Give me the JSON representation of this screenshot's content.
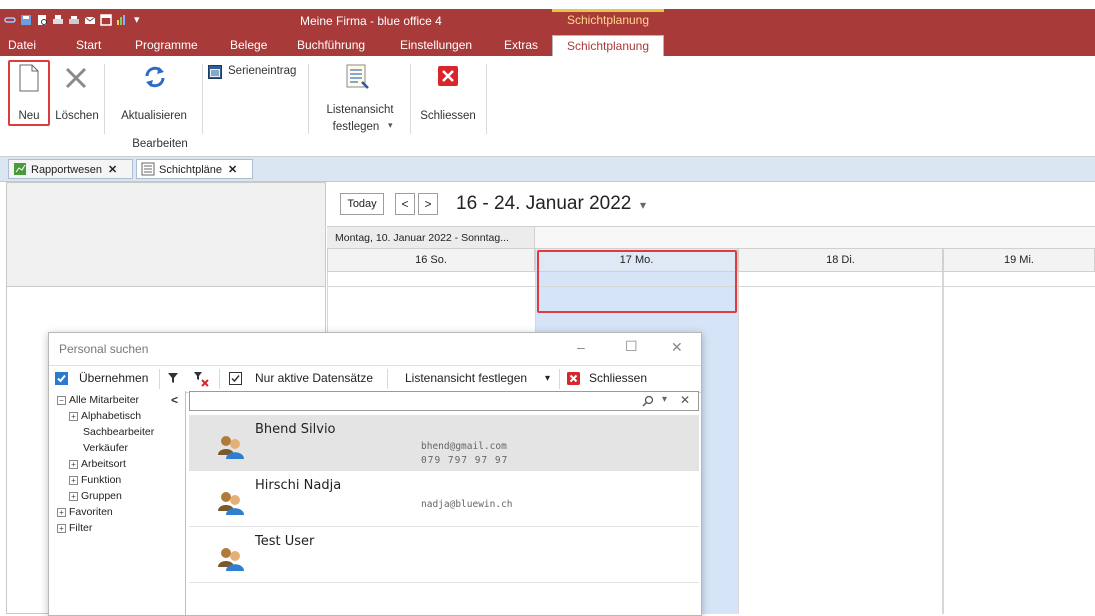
{
  "window": {
    "title": "Meine Firma - blue office 4",
    "context_tab_group": "Schichtplanung"
  },
  "menu": {
    "tabs": [
      "Datei",
      "Start",
      "Programme",
      "Belege",
      "Buchführung",
      "Einstellungen",
      "Extras"
    ],
    "active_tab": "Schichtplanung"
  },
  "ribbon": {
    "new_label": "Neu",
    "delete_label": "Löschen",
    "refresh_label": "Aktualisieren",
    "series_label": "Serieneintrag",
    "group_edit_label": "Bearbeiten",
    "list_view_label_1": "Listenansicht",
    "list_view_label_2": "festlegen",
    "close_label": "Schliessen"
  },
  "doc_tabs": [
    "Rapportwesen",
    "Schichtpläne"
  ],
  "calendar": {
    "today_label": "Today",
    "prev_icon": "chevron-left-icon",
    "next_icon": "chevron-right-icon",
    "range_label": "16 - 24. Januar 2022",
    "period_label": "Montag, 10. Januar 2022 - Sonntag...",
    "days": [
      "16 So.",
      "17 Mo.",
      "18 Di.",
      "19 Mi."
    ]
  },
  "dialog": {
    "title": "Personal suchen",
    "toolbar": {
      "apply_label": "Übernehmen",
      "active_only_label": "Nur aktive Datensätze",
      "list_view_label": "Listenansicht festlegen",
      "close_label": "Schliessen"
    },
    "tree": {
      "collapse_glyph": "<",
      "items": [
        {
          "label": "Alle Mitarbeiter",
          "level": 0,
          "expander": "−"
        },
        {
          "label": "Alphabetisch",
          "level": 1,
          "expander": "+"
        },
        {
          "label": "Sachbearbeiter",
          "level": 2,
          "expander": ""
        },
        {
          "label": "Verkäufer",
          "level": 2,
          "expander": ""
        },
        {
          "label": "Arbeitsort",
          "level": 1,
          "expander": "+"
        },
        {
          "label": "Funktion",
          "level": 1,
          "expander": "+"
        },
        {
          "label": "Gruppen",
          "level": 1,
          "expander": "+"
        },
        {
          "label": "Favoriten",
          "level": 0,
          "expander": "+"
        },
        {
          "label": "Filter",
          "level": 0,
          "expander": "+"
        }
      ]
    },
    "results": [
      {
        "name": "Bhend Silvio",
        "email": "bhend@gmail.com",
        "phone": "079 797 97 97"
      },
      {
        "name": "Hirschi Nadja",
        "email": "nadja@bluewin.ch",
        "phone": ""
      },
      {
        "name": "Test User",
        "email": "",
        "phone": ""
      }
    ]
  },
  "colors": {
    "brand": "#a93a3a",
    "highlight": "#e0393e",
    "selected_column": "#d6e4f7"
  }
}
